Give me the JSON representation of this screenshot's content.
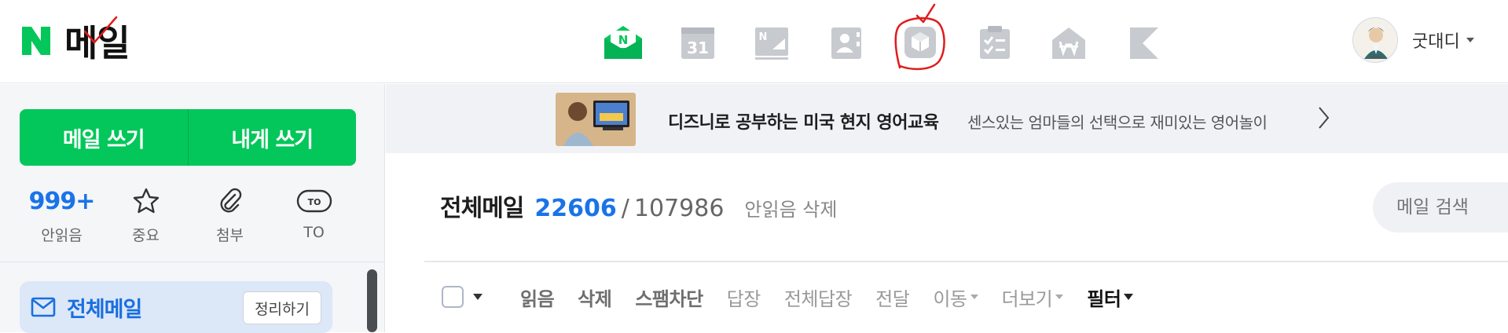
{
  "header": {
    "logo_title": "메일",
    "user_name": "굿대디"
  },
  "apps": [
    {
      "icon": "mail-app-icon",
      "label": "N"
    },
    {
      "icon": "calendar-app-icon",
      "label": "31"
    },
    {
      "icon": "news-app-icon",
      "label": "N"
    },
    {
      "icon": "contacts-app-icon"
    },
    {
      "icon": "mybox-app-icon"
    },
    {
      "icon": "todo-app-icon"
    },
    {
      "icon": "household-account-app-icon"
    },
    {
      "icon": "bookmark-app-icon"
    }
  ],
  "sidebar": {
    "compose_label": "메일 쓰기",
    "self_compose_label": "내게 쓰기",
    "quick": [
      {
        "count": "999+",
        "label": "안읽음"
      },
      {
        "icon": "star-icon",
        "label": "중요"
      },
      {
        "icon": "attachment-icon",
        "label": "첨부"
      },
      {
        "icon": "to-icon",
        "badge": "TO",
        "label": "TO"
      }
    ],
    "all_mail_label": "전체메일",
    "organize_label": "정리하기"
  },
  "banner": {
    "title": "디즈니로 공부하는 미국 현지 영어교육",
    "subtitle": "센스있는 엄마들의 선택으로 재미있는 영어놀이"
  },
  "main": {
    "title": "전체메일",
    "unread_count": "22606",
    "slash": "/",
    "total_count": "107986",
    "delete_unread": "안읽음 삭제",
    "search_placeholder": "메일 검색"
  },
  "toolbar": {
    "read": "읽음",
    "delete": "삭제",
    "spam": "스팸차단",
    "reply": "답장",
    "reply_all": "전체답장",
    "forward": "전달",
    "move": "이동",
    "more": "더보기",
    "filter": "필터"
  },
  "colors": {
    "brand_green": "#03c75a",
    "accent_blue": "#1a73e8",
    "annotation_red": "#e01b1b"
  }
}
